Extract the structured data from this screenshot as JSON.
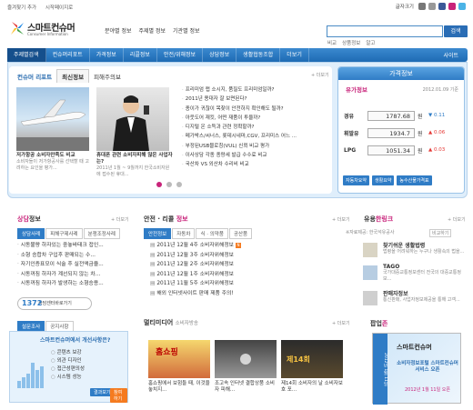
{
  "top": {
    "links": [
      "즐겨찾기 추가",
      "시작페이지로"
    ],
    "font_label": "글자크기"
  },
  "logo": {
    "korean": "스마트컨슈머",
    "english": "Consumer Information"
  },
  "subnav": [
    "분야별 정보",
    "주제별 정보",
    "기관별 정보"
  ],
  "search": {
    "button": "검색",
    "quick": [
      "비교",
      "상품정보",
      "알고"
    ]
  },
  "mainnav": {
    "items": [
      "주제별검색",
      "컨슈머리포트",
      "가격정보",
      "리콜정보",
      "안전/위해정보",
      "상담정보",
      "생활협동조합",
      "더보기"
    ],
    "sitemap": "사이트"
  },
  "report": {
    "tabs": [
      "컨슈머 리포트",
      "최신정보",
      "피해주의보"
    ],
    "more": "+ 더보기",
    "feature1": {
      "title": "저가항공 소비자만족도 비교",
      "desc": "소비자들이 저가항공사를 선택할 때 고려하는 요인을 평가..."
    },
    "feature2": {
      "title": "휴대폰 관련 소비자피해 많은 사업자는?",
      "desc": "2011년 1월 ~ 9월까지 한국소비자원에 접수된 휴대..."
    },
    "news": [
      "프리미엄 랩 소시지, 품질도 프리미엄일까?",
      "2011년 용대자 잘 보면된다?",
      "종이가 귀찮이 목찾이 안전하지 확인해도 될까?",
      "아웃도어 재킷, 어떤 재품이 투율까?",
      "디지털 온 소득과 관련 정확할까?",
      "메가박스/씨너스, 롯데시네마,CGV, 프리미스 어느 ...",
      "부정된USB블로칭(VUL) 신뢰 비교 평가",
      "이사상담 각종 종량세 발급 수수료 비교",
      "국산차 VS 외산차 수리비 비교"
    ]
  },
  "price": {
    "header": "가격정보",
    "subtitle": "유가정보",
    "subtitle_unit": "단위/리터",
    "date": "2012.01.09 기준",
    "rows": [
      {
        "name": "경유",
        "value": "1787.68",
        "unit": "원",
        "change": "▼ 0.11",
        "dir": "down"
      },
      {
        "name": "휘발유",
        "value": "1934.7",
        "unit": "원",
        "change": "▲ 0.06",
        "dir": "up"
      },
      {
        "name": "LPG",
        "value": "1051.34",
        "unit": "원",
        "change": "▲ 0.03",
        "dir": "up"
      }
    ],
    "source": "※자료제공: 한국석유공사",
    "more": "비교하기",
    "buttons": [
      "자동차요약",
      "생활요약",
      "생필품가격표",
      "농수산물가격표"
    ]
  },
  "consult": {
    "title_a": "상담",
    "title_b": "정보",
    "more": "+ 더보기",
    "tabs": [
      "상담사례",
      "피해구제사례",
      "분쟁조정사례"
    ],
    "items": [
      "시동불량 하자있는 중놓바태크 접인...",
      "소형 승합차 구입후 판매되는 수...",
      "자기인증표모이 식술 후 실전액금을...",
      "시동꺼짐 하자가 계선되지 않는 차...",
      "시동꺼짐 하자가 발생하는 소형승용..."
    ],
    "call_num": "1372",
    "call_label": "상담센터바로가기"
  },
  "survey": {
    "tabs": [
      "설문조사",
      "공지사항"
    ],
    "title": "스마트컨슈머에서 개선사항은?",
    "options": [
      "콘텐츠 보강",
      "외관 디자인",
      "접근성편의성",
      "시스템 성능"
    ],
    "bars": [
      8,
      12,
      16,
      28,
      20,
      24
    ],
    "btn_result": "결과보기",
    "btn_vote": "참여하기"
  },
  "safety": {
    "title_a": "안전 · 리콜",
    "title_b": "정보",
    "more": "+ 더보기",
    "tabs": [
      "안전정보",
      "자동차",
      "식 · 의약품",
      "공산품"
    ],
    "items": [
      "2011년 12월 4주 소비자위해정보",
      "2011년 12월 3주 소비자위해정보",
      "2011년 12월 2주 소비자위해정보",
      "2011년 12월 1주 소비자위해정보",
      "2011년 11월 5주 소비자위해정보",
      "해외 인터넷사이트 판매 제품 주의!"
    ]
  },
  "multimedia": {
    "title": "멀티미디어",
    "sub": "소비자방송",
    "more": "+ 더보기",
    "items": [
      {
        "title": "홈쇼핑에서 보험들 때, 이것을 놓치지...",
        "thumb": "홈쇼핑"
      },
      {
        "title": "조고속 인터넷 결합상품 소비자 피해...",
        "thumb": ""
      },
      {
        "title": "제14회 소비자의 날 소비자보호 포...",
        "thumb": "제14회"
      }
    ]
  },
  "sites": {
    "title_a": "유용",
    "title_b": "한링크",
    "more": "+ 더보기",
    "items": [
      {
        "name": "찾기쉬운 생활법령",
        "desc": "법령을 어려워하는 누구나 생활속의 법을..."
      },
      {
        "name": "TAGO",
        "desc": "국가대중교통정보센터 전국의 대중교통정보..."
      },
      {
        "name": "판매자정보",
        "desc": "통신판매, 사업자정보제공을 통해 고객..."
      }
    ]
  },
  "popup": {
    "title_a": "팝업",
    "title_b": "존",
    "logo": "스마트컨슈머",
    "text": "소비자정보포털 스마트컨슈머 서비스 오픈",
    "date": "2012년 1월 11일 오픈",
    "side": "2012년 1월 11일"
  },
  "colors": {
    "brand_blue": "#2f7cc6",
    "accent": "#c8237a",
    "nav_dark": "#154f8c"
  }
}
